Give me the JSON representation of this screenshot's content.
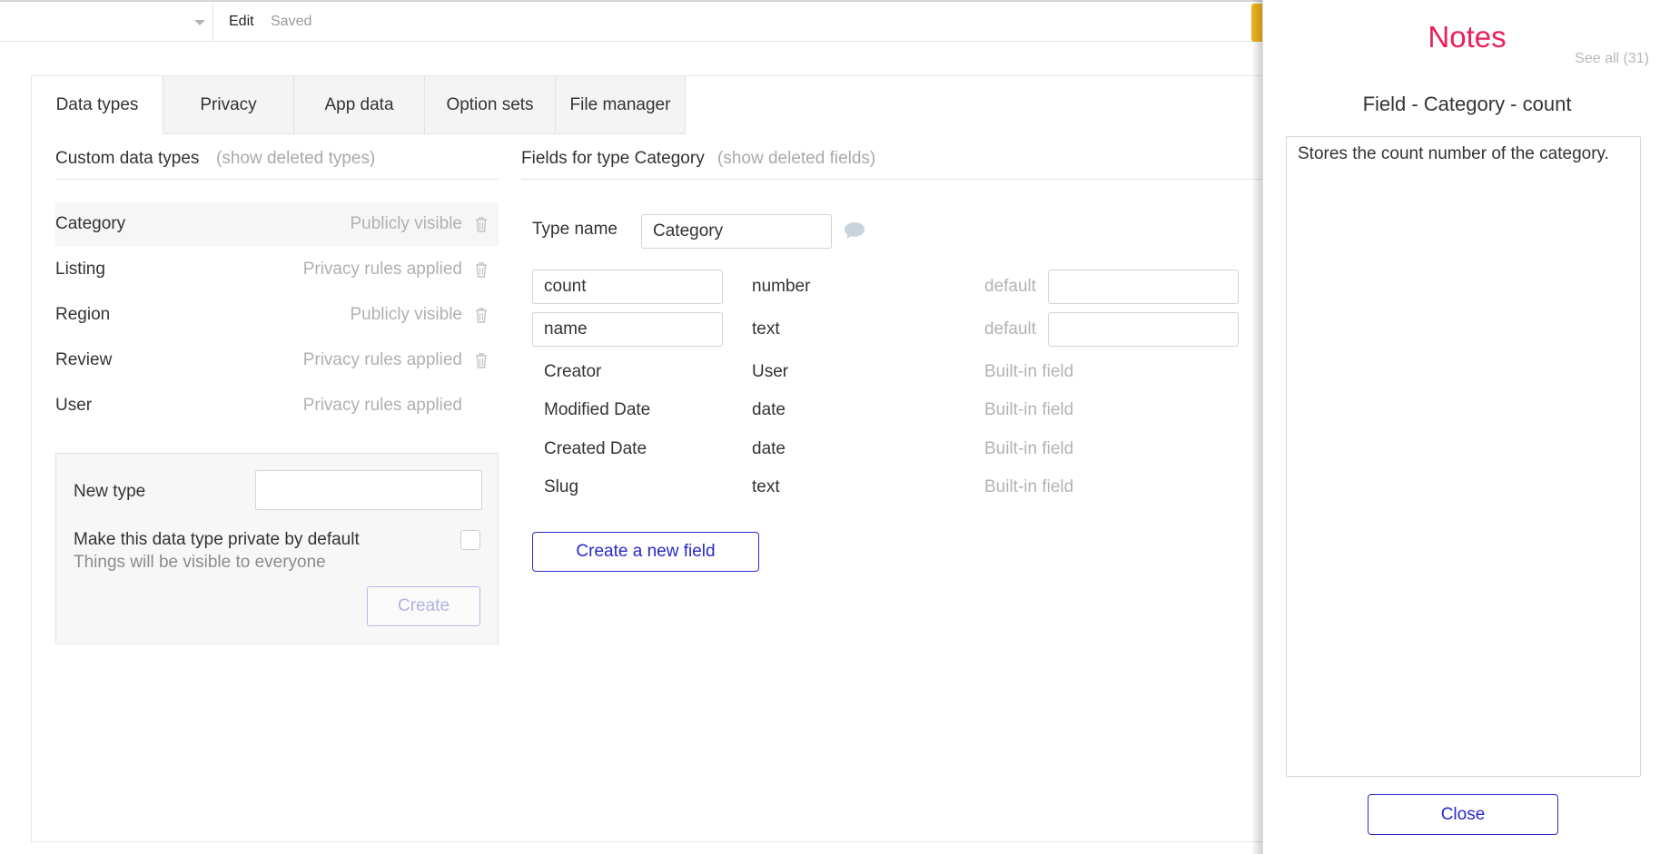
{
  "topbar": {
    "mode_label": "Edit",
    "status_label": "Saved"
  },
  "tabs": [
    {
      "label": "Data types",
      "active": true
    },
    {
      "label": "Privacy"
    },
    {
      "label": "App data"
    },
    {
      "label": "Option sets"
    },
    {
      "label": "File manager"
    }
  ],
  "custom_types": {
    "title": "Custom data types",
    "show_deleted": "(show deleted types)",
    "items": [
      {
        "name": "Category",
        "visibility": "Publicly visible",
        "selected": true
      },
      {
        "name": "Listing",
        "visibility": "Privacy rules applied"
      },
      {
        "name": "Region",
        "visibility": "Publicly visible"
      },
      {
        "name": "Review",
        "visibility": "Privacy rules applied"
      },
      {
        "name": "User",
        "visibility": "Privacy rules applied"
      }
    ]
  },
  "new_type": {
    "label": "New type",
    "input_value": "",
    "private_label": "Make this data type private by default",
    "private_hint": "Things will be visible to everyone",
    "private_checked": false,
    "create_label": "Create"
  },
  "fields_panel": {
    "title": "Fields for type Category",
    "show_deleted": "(show deleted fields)",
    "type_name_label": "Type name",
    "type_name_value": "Category",
    "fields": [
      {
        "name": "count",
        "type": "number",
        "default_label": "default",
        "default_value": ""
      },
      {
        "name": "name",
        "type": "text",
        "default_label": "default",
        "default_value": ""
      }
    ],
    "builtin_fields": [
      {
        "name": "Creator",
        "type": "User",
        "note": "Built-in field"
      },
      {
        "name": "Modified Date",
        "type": "date",
        "note": "Built-in field"
      },
      {
        "name": "Created Date",
        "type": "date",
        "note": "Built-in field"
      },
      {
        "name": "Slug",
        "type": "text",
        "note": "Built-in field"
      }
    ],
    "create_field_label": "Create a new field"
  },
  "notes": {
    "title": "Notes",
    "see_all": "See all (31)",
    "subtitle": "Field - Category - count",
    "text": "Stores the count number of the category.",
    "close_label": "Close",
    "title_color": "#e8215a",
    "button_color": "#2727c9"
  },
  "icons": {
    "page_dropdown": "chevron-down-icon",
    "delete": "trash-icon",
    "note": "comment-icon"
  }
}
